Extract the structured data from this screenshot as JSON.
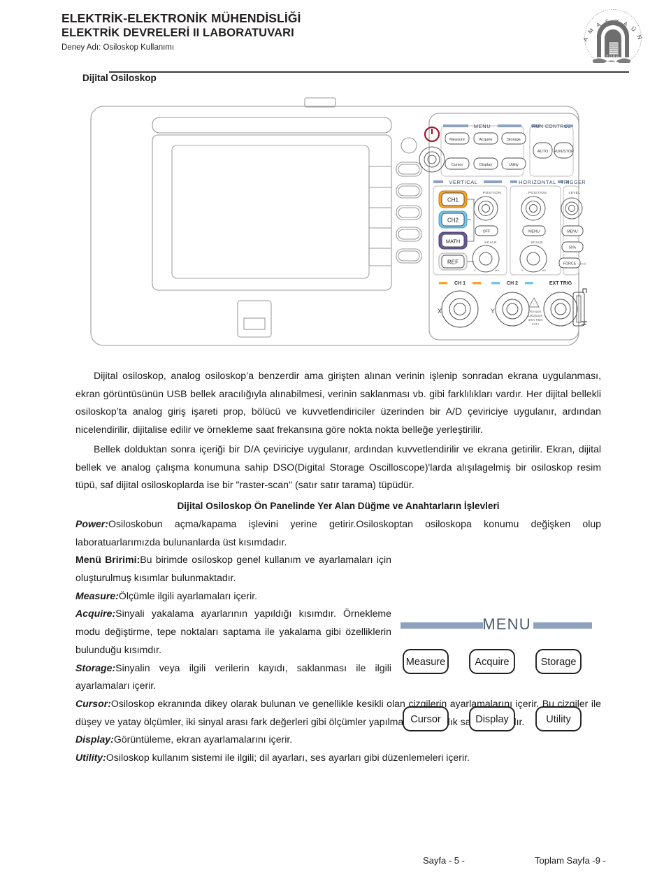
{
  "header": {
    "line1": "ELEKTRİK-ELEKTRONİK MÜHENDİSLİĞİ",
    "line2": "ELEKTRİK DEVRELERİ II LABORATUVARI",
    "line3": "Deney Adı: Osiloskop Kullanımı",
    "logo": {
      "name": "amasya-universitesi-logo",
      "arc_text": "AMASYA ÜNİVERSİTESİ",
      "year": "2006"
    }
  },
  "section": {
    "title": "Dijital Osiloskop"
  },
  "figure_scope": {
    "name": "digital-oscilloscope-front-panel",
    "groups": {
      "menu": "MENU",
      "run_control": "RUN CONTROL",
      "vertical": "VERTICAL",
      "horizontal": "HORIZONTAL",
      "trigger": "TRIGGER"
    },
    "menu_buttons": [
      "Measure",
      "Acquire",
      "Storage",
      "Cursor",
      "Display",
      "Utility"
    ],
    "run_control_buttons": [
      "AUTO",
      "RUN/STOP"
    ],
    "channel_buttons": [
      "CH1",
      "CH2",
      "MATH",
      "REF"
    ],
    "vertical": {
      "position": "POSITION",
      "off": "OFF",
      "scale": "SCALE",
      "min": "V",
      "max": "mV"
    },
    "horizontal": {
      "position": "POSITION",
      "menu": "MENU",
      "scale": "SCALE",
      "min": "S",
      "max": "nS"
    },
    "trigger": {
      "level": "LEVEL",
      "menu": "MENU",
      "fifty": "50%",
      "force": "FORCE",
      "local": "Local"
    },
    "inputs": {
      "ch1": "CH 1",
      "ch2": "CH 2",
      "ext": "EXT TRIG",
      "x": "X",
      "y": "Y"
    },
    "warning": [
      "All Inputs",
      "1MΩ||15pF",
      "300V RMS",
      "CAT I"
    ],
    "colors": {
      "ch1": "#F3A42A",
      "ch2": "#73C6EA",
      "math": "#6A5A97",
      "ref": "#FFFFFF",
      "group_bar": "#8EA2C0",
      "power": "#9B1B30"
    }
  },
  "content": {
    "p1": "Dijital osiloskop, analog osiloskop’a benzerdir ama girişten alınan verinin işlenip sonradan ekrana uygulanması, ekran görüntüsünün USB bellek aracılığıyla alınabilmesi, verinin saklanması vb. gibi farklılıkları vardır. Her dijital bellekli osiloskop’ta analog giriş işareti prop, bölücü ve kuvvetlendiriciler üzerinden bir A/D çeviriciye uygulanır, ardından nicelendirilir, dijitalise edilir ve örnekleme saat frekansına göre nokta nokta belleğe yerleştirilir.",
    "p2": "Bellek dolduktan sonra içeriği bir D/A çeviriciye uygulanır, ardından kuvvetlendirilir ve ekrana getirilir. Ekran, dijital bellek ve analog çalışma konumuna sahip DSO(Digital Storage Oscilloscope)'larda alışılagelmiş bir osiloskop resim tüpü, saf dijital osiloskoplarda ise bir \"raster-scan\" (satır satır tarama) tüpüdür.",
    "subhead": "Dijital Osiloskop Ön Panelinde Yer Alan Düğme ve Anahtarların İşlevleri",
    "power_label": "Power:",
    "power_text": "Osiloskobun açma/kapama işlevini yerine getirir.Osiloskoptan osiloskopa konumu değişken olup laboratuarlarımızda bulunanlarda üst kısımdadır.",
    "menu_label": "Menü Bririmi:",
    "menu_text": "Bu birimde osiloskop genel kullanım ve ayarlamaları için oluşturulmuş kısımlar bulunmaktadır.",
    "measure_label": "Measure:",
    "measure_text": "Ölçümle ilgili ayarlamaları içerir.",
    "acquire_label": "Acquire:",
    "acquire_text": "Sinyali yakalama ayarlarının yapıldığı kısımdır. Örnekleme modu değiştirme, tepe noktaları saptama ile yakalama gibi özelliklerin bulunduğu kısımdır.",
    "storage_label": "Storage:",
    "storage_text": "Sinyalin veya ilgili verilerin kayıdı, saklanması ile ilgili ayarlamaları içerir.",
    "cursor_label": "Cursor:",
    "cursor_text": "Osiloskop ekranında dikey olarak bulunan ve genellikle kesikli olan çizgilerin ayarlamalarını içerir. Bu çizgiler ile düşey ve yatay ölçümler, iki sinyal arası fark değerleri gibi ölçümler yapılmasına kolaylık sağlamaktadır.",
    "display_label": "Display:",
    "display_text": "Görüntüleme, ekran ayarlamalarını içerir.",
    "utility_label": "Utility:",
    "utility_text": "Osiloskop kullanım sistemi ile ilgili; dil ayarları, ses ayarları gibi düzenlemeleri içerir."
  },
  "figure_menu": {
    "name": "menu-unit-closeup",
    "title": "MENU",
    "buttons": [
      "Measure",
      "Acquire",
      "Storage",
      "Cursor",
      "Display",
      "Utility"
    ],
    "bar_color": "#8EA2C0"
  },
  "footer": {
    "page": "Sayfa - 5 -",
    "total": "Toplam Sayfa -9 -"
  }
}
